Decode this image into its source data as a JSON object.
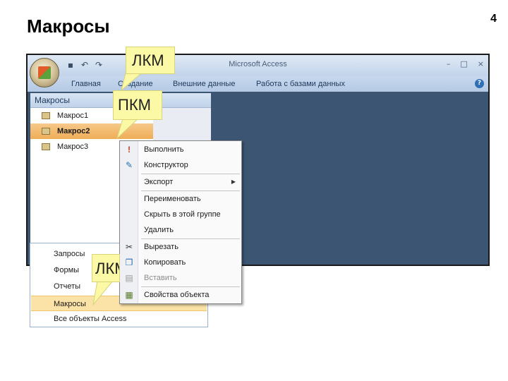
{
  "slide": {
    "title": "Макросы",
    "page_number": "4"
  },
  "window": {
    "title": "Microsoft Access",
    "controls": [
      "–",
      "□",
      "×"
    ],
    "tabs": [
      "Главная",
      "Создание",
      "Внешние данные",
      "Работа с базами данных"
    ],
    "help": "?"
  },
  "nav": {
    "header": "Макросы",
    "items": [
      "Макрос1",
      "Макрос2",
      "Макрос3"
    ],
    "selected": "Макрос2"
  },
  "dropdown": {
    "items": [
      "Запросы",
      "Формы",
      "Отчеты",
      "Макросы",
      "Все объекты Access"
    ],
    "selected": "Макросы"
  },
  "context_menu": {
    "items": [
      {
        "label": "Выполнить",
        "icon": "run-icon"
      },
      {
        "label": "Конструктор",
        "icon": "design-icon"
      },
      {
        "label": "Экспорт",
        "icon": "",
        "submenu": true
      },
      {
        "label": "Переименовать",
        "icon": ""
      },
      {
        "label": "Скрыть в этой группе",
        "icon": ""
      },
      {
        "label": "Удалить",
        "icon": ""
      },
      {
        "label": "Вырезать",
        "icon": "scissors-icon"
      },
      {
        "label": "Копировать",
        "icon": "copy-icon"
      },
      {
        "label": "Вставить",
        "icon": "paste-icon",
        "disabled": true
      },
      {
        "label": "Свойства объекта",
        "icon": "properties-icon"
      }
    ]
  },
  "callouts": {
    "top": "ЛКМ",
    "middle": "ПКМ",
    "bottom": "ЛКМ"
  }
}
